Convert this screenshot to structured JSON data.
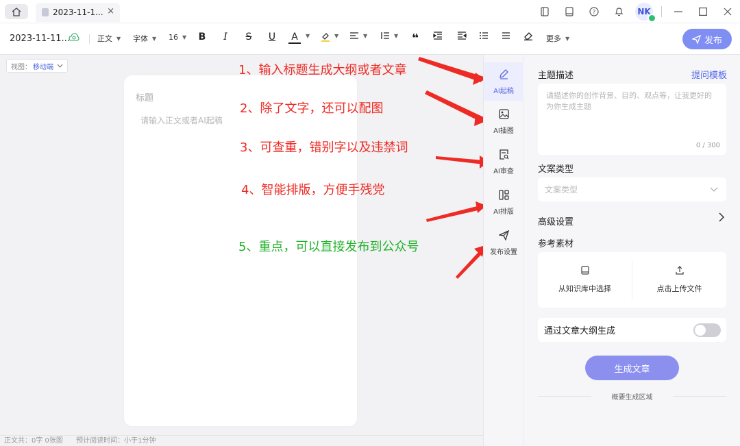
{
  "tab": {
    "title": "2023-11-1...",
    "close": "×"
  },
  "titlebar": {
    "avatar": "NK"
  },
  "toolbar": {
    "doc_name": "2023-11-11...",
    "paragraph_style": "正文",
    "font": "字体",
    "font_size": "16",
    "bold": "B",
    "italic": "I",
    "strike": "S",
    "underline": "U",
    "font_color": "A",
    "more": "更多",
    "publish_label": "发布"
  },
  "editor": {
    "view_label": "视图：",
    "view_value": "移动端",
    "title_placeholder": "标题",
    "body_placeholder": "请输入正文或者AI起稿"
  },
  "annotations": [
    "1、输入标题生成大纲或者文章",
    "2、除了文字，还可以配图",
    "3、可查重，错别字以及违禁词",
    "4、智能排版，方便手残党",
    "5、重点，可以直接发布到公众号"
  ],
  "status": {
    "word_count": "正文共：0字 0张图",
    "reading_time": "预计阅读时间：小于1分钟"
  },
  "rail": [
    {
      "label": "AI起稿",
      "icon": "pencil-icon"
    },
    {
      "label": "AI插图",
      "icon": "image-icon"
    },
    {
      "label": "AI审查",
      "icon": "search-doc-icon"
    },
    {
      "label": "AI排版",
      "icon": "layout-icon"
    },
    {
      "label": "发布设置",
      "icon": "send-icon"
    }
  ],
  "panel": {
    "topic_label": "主题描述",
    "template_link": "提问模板",
    "topic_placeholder": "请描述你的创作背景、目的、观点等，让我更好的为你生成主题",
    "topic_count": "0 / 300",
    "copy_type_label": "文案类型",
    "copy_type_placeholder": "文案类型",
    "advanced_label": "高级设置",
    "material_label": "参考素材",
    "from_kb": "从知识库中选择",
    "upload": "点击上传文件",
    "outline_toggle_label": "通过文章大纲生成",
    "outline_toggle_on": false,
    "generate_button": "生成文章",
    "footnote": "概要生成区域"
  },
  "colors": {
    "accent": "#7f8ef3",
    "annotation_red": "#ee2a24",
    "annotation_green": "#22b22a",
    "link": "#4f63e8"
  }
}
